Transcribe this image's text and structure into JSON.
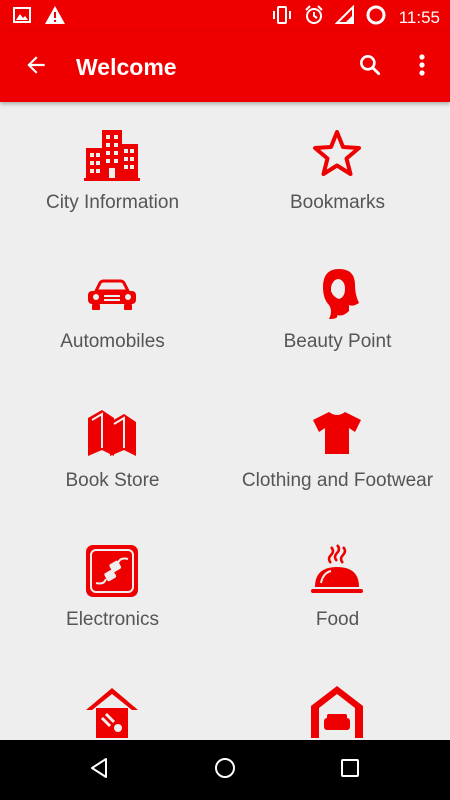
{
  "status_bar": {
    "time": "11:55",
    "icons": [
      "image-icon",
      "warning-icon",
      "vibrate-icon",
      "alarm-icon",
      "signal-icon",
      "battery-icon"
    ]
  },
  "app_bar": {
    "title": "Welcome",
    "back_icon": "arrow-back-icon",
    "search_icon": "search-icon",
    "more_icon": "more-vert-icon"
  },
  "categories": [
    {
      "label": "City Information",
      "icon": "buildings-icon"
    },
    {
      "label": "Bookmarks",
      "icon": "star-icon"
    },
    {
      "label": "Automobiles",
      "icon": "car-icon"
    },
    {
      "label": "Beauty Point",
      "icon": "woman-icon"
    },
    {
      "label": "Book Store",
      "icon": "books-icon"
    },
    {
      "label": "Clothing and Footwear",
      "icon": "tshirt-icon"
    },
    {
      "label": "Electronics",
      "icon": "plug-icon"
    },
    {
      "label": "Food",
      "icon": "food-cloche-icon"
    },
    {
      "label": "",
      "icon": "home-repair-icon"
    },
    {
      "label": "",
      "icon": "home-furniture-icon"
    }
  ],
  "nav_bar": {
    "icons": [
      "back-triangle-icon",
      "home-circle-icon",
      "recents-square-icon"
    ]
  },
  "colors": {
    "primary": "#ee0000",
    "icon": "#ee0000",
    "background": "#eeeeee",
    "label_text": "#555555",
    "nav_bar": "#000000"
  }
}
